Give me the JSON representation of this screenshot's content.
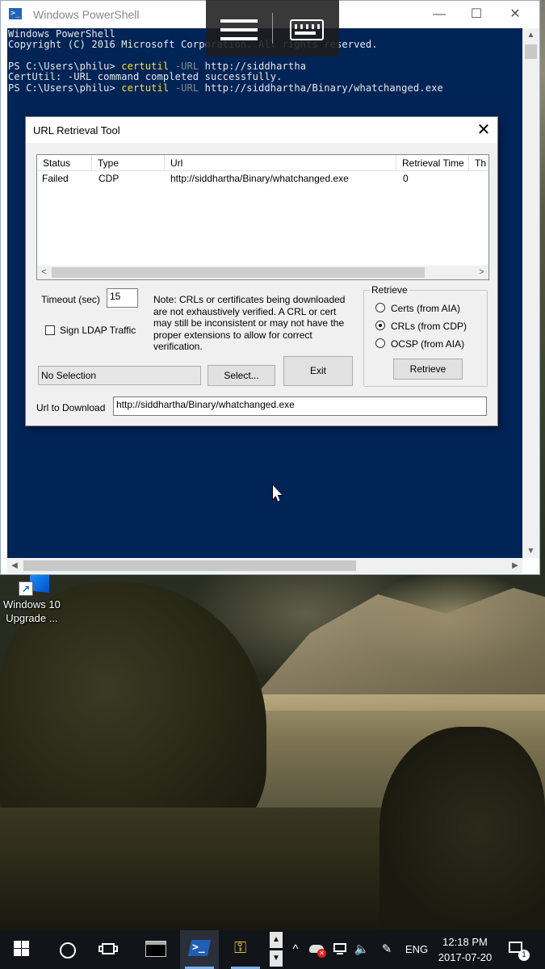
{
  "powershell": {
    "title": "Windows PowerShell",
    "banner1": "Windows PowerShell",
    "banner2": "Copyright (C) 2016 Microsoft Corporation. All rights reserved.",
    "prompt1": "PS C:\\Users\\philu> ",
    "cmd1": "certutil",
    "param1": " -URL",
    "arg1": " http://siddhartha",
    "output1": "CertUtil: -URL command completed successfully.",
    "prompt2": "PS C:\\Users\\philu> ",
    "cmd2": "certutil",
    "param2": " -URL",
    "arg2": " http://siddhartha/Binary/whatchanged.exe"
  },
  "dialog": {
    "title": "URL Retrieval Tool",
    "columns": [
      "Status",
      "Type",
      "Url",
      "Retrieval Time",
      "Th"
    ],
    "rows": [
      {
        "status": "Failed",
        "type": "CDP",
        "url": "http://siddhartha/Binary/whatchanged.exe",
        "time": "0"
      }
    ],
    "timeout_label": "Timeout (sec)",
    "timeout_value": "15",
    "sign_ldap_label": "Sign LDAP Traffic",
    "note": "Note: CRLs or certificates being downloaded are not exhaustively verified.  A CRL or cert may still be inconsistent or may not have the proper extensions to allow for correct verification.",
    "selection_text": "No Selection",
    "select_button": "Select...",
    "exit_button": "Exit",
    "retrieve_group": "Retrieve",
    "radio_certs": "Certs (from AIA)",
    "radio_crls": "CRLs (from CDP)",
    "radio_ocsp": "OCSP (from AIA)",
    "selected_radio": "CRLs (from CDP)",
    "retrieve_button": "Retrieve",
    "url_label": "Url to Download",
    "url_value": "http://siddhartha/Binary/whatchanged.exe"
  },
  "desktop": {
    "icon_label_line1": "Windows 10",
    "icon_label_line2": "Upgrade ..."
  },
  "taskbar": {
    "language": "ENG",
    "time": "12:18 PM",
    "date": "2017-07-20",
    "notification_count": "1"
  },
  "colors": {
    "console_bg": "#012456",
    "console_cmd": "#f5e13a",
    "taskbar_bg": "#111419"
  }
}
